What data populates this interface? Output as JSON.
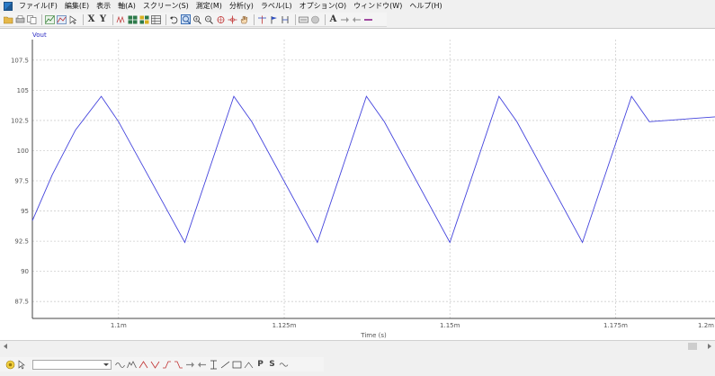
{
  "menu": {
    "items": [
      "ファイル(F)",
      "編集(E)",
      "表示",
      "軸(A)",
      "スクリーン(S)",
      "測定(M)",
      "分析(y)",
      "ラベル(L)",
      "オプション(O)",
      "ウィンドウ(W)",
      "ヘルプ(H)"
    ]
  },
  "toolbar": {
    "x_label": "X",
    "y_label": "Y",
    "text_label": "A"
  },
  "bottombar": {
    "p_label": "P",
    "s_label": "S"
  },
  "colors": {
    "trace": "#4444dd",
    "trace_label": "#2b2bc4"
  },
  "chart_data": {
    "type": "line",
    "trace_name": "Vout",
    "xlabel": "Time (s)",
    "x_range": [
      0.001087,
      0.00119
    ],
    "y_range": [
      86.1,
      109.2
    ],
    "x_ticks": [
      {
        "value": 0.0011,
        "label": "1.1m"
      },
      {
        "value": 0.001125,
        "label": "1.125m"
      },
      {
        "value": 0.00115,
        "label": "1.15m"
      },
      {
        "value": 0.001175,
        "label": "1.175m"
      },
      {
        "value": 0.0012,
        "label": "1.2m"
      }
    ],
    "y_ticks": [
      {
        "value": 107.5,
        "label": "107.5"
      },
      {
        "value": 105,
        "label": "105"
      },
      {
        "value": 102.5,
        "label": "102.5"
      },
      {
        "value": 100,
        "label": "100"
      },
      {
        "value": 97.5,
        "label": "97.5"
      },
      {
        "value": 95,
        "label": "95"
      },
      {
        "value": 92.5,
        "label": "92.5"
      },
      {
        "value": 90,
        "label": "90"
      },
      {
        "value": 87.5,
        "label": "87.5"
      }
    ],
    "series": [
      {
        "name": "Vout",
        "x": [
          0.001087,
          0.00109,
          0.0010935,
          0.0010974,
          0.0011,
          0.00111,
          0.0011174,
          0.0011201,
          0.00113,
          0.0011374,
          0.0011401,
          0.00115,
          0.0011574,
          0.0011601,
          0.00117,
          0.0011774,
          0.0011801,
          0.00119
        ],
        "y": [
          94.2,
          98.0,
          101.7,
          104.5,
          102.4,
          92.4,
          104.5,
          102.4,
          92.4,
          104.5,
          102.4,
          92.4,
          104.5,
          102.4,
          92.4,
          104.5,
          102.4,
          102.8
        ]
      }
    ],
    "grid": true
  }
}
